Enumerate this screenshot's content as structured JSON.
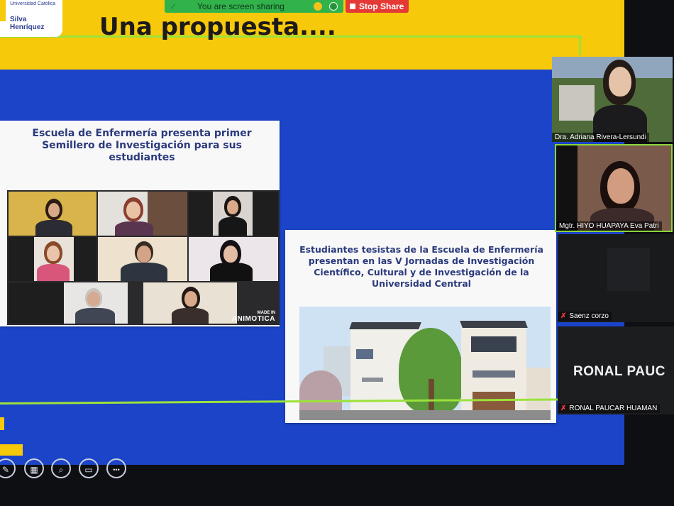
{
  "share_bar": {
    "status": "You are screen sharing",
    "stop_label": "Stop Share"
  },
  "slide": {
    "logo_line1": "Universidad Católica",
    "logo_line2": "Silva Henríquez",
    "title": "Una propuesta....",
    "card1_title": "Escuela de Enfermería presenta primer Semillero de Investigación para sus estudiantes",
    "watermark_top": "MADE IN",
    "watermark_bottom": "ANIMOTICA",
    "card2_title": "Estudiantes tesistas de la Escuela de Enfermería presentan en las V Jornadas de Investigación Científico, Cultural y de Investigación de la Universidad Central"
  },
  "participants": [
    {
      "name": "Dra. Adriana Rivera-Lersundi"
    },
    {
      "name": "Mgtr. HIYO HUAPAYA Eva Patri"
    },
    {
      "name": "Saenz corzo"
    },
    {
      "name": "RONAL PAUCAR HUAMAN",
      "big_label": "RONAL PAUC"
    }
  ],
  "toolbar": {
    "icons": [
      "pen-icon",
      "layout-icon",
      "zoom-icon",
      "slideshow-icon",
      "more-icon"
    ],
    "more_label": "•••"
  },
  "colors": {
    "slide_blue": "#1b44c8",
    "slide_yellow": "#f6c90a",
    "accent_green": "#9be23a",
    "share_green": "#31b24a",
    "stop_red": "#e53935"
  }
}
